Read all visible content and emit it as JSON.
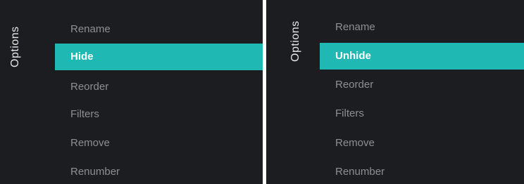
{
  "screens": [
    {
      "title": "Options",
      "items": [
        {
          "label": "Rename"
        },
        {
          "label": "Hide"
        },
        {
          "label": "Reorder"
        },
        {
          "label": "Filters"
        },
        {
          "label": "Remove"
        },
        {
          "label": "Renumber"
        }
      ],
      "selected_index": 1
    },
    {
      "title": "Options",
      "items": [
        {
          "label": "Rename"
        },
        {
          "label": "Unhide"
        },
        {
          "label": "Reorder"
        },
        {
          "label": "Filters"
        },
        {
          "label": "Remove"
        },
        {
          "label": "Renumber"
        }
      ],
      "selected_index": 1
    }
  ],
  "colors": {
    "background": "#1c1d20",
    "highlight": "#1fb8b3",
    "item_text": "#8d8f92",
    "selected_text": "#ffffff"
  }
}
